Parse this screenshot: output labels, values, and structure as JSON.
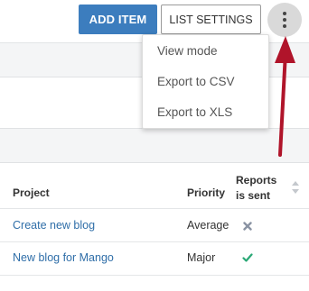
{
  "toolbar": {
    "add_item_label": "ADD ITEM",
    "list_settings_label": "LIST SETTINGS",
    "more_icon": "more-vertical-icon"
  },
  "dropdown": {
    "items": [
      {
        "label": "View mode"
      },
      {
        "label": "Export to CSV"
      },
      {
        "label": "Export to XLS"
      }
    ]
  },
  "table": {
    "columns": {
      "project": "Project",
      "priority": "Priority",
      "reports_line1": "Reports",
      "reports_line2": "is sent"
    },
    "rows": [
      {
        "project": "Create new blog",
        "priority": "Average",
        "reports_sent": "no",
        "status_icon": "cross-icon"
      },
      {
        "project": "New blog for Mango",
        "priority": "Major",
        "reports_sent": "yes",
        "status_icon": "check-icon"
      }
    ]
  },
  "colors": {
    "primary": "#3c7dbe",
    "link": "#2f6ea8",
    "annotation_arrow": "#b0142a",
    "check": "#2aa876",
    "cross": "#8a93a3"
  }
}
